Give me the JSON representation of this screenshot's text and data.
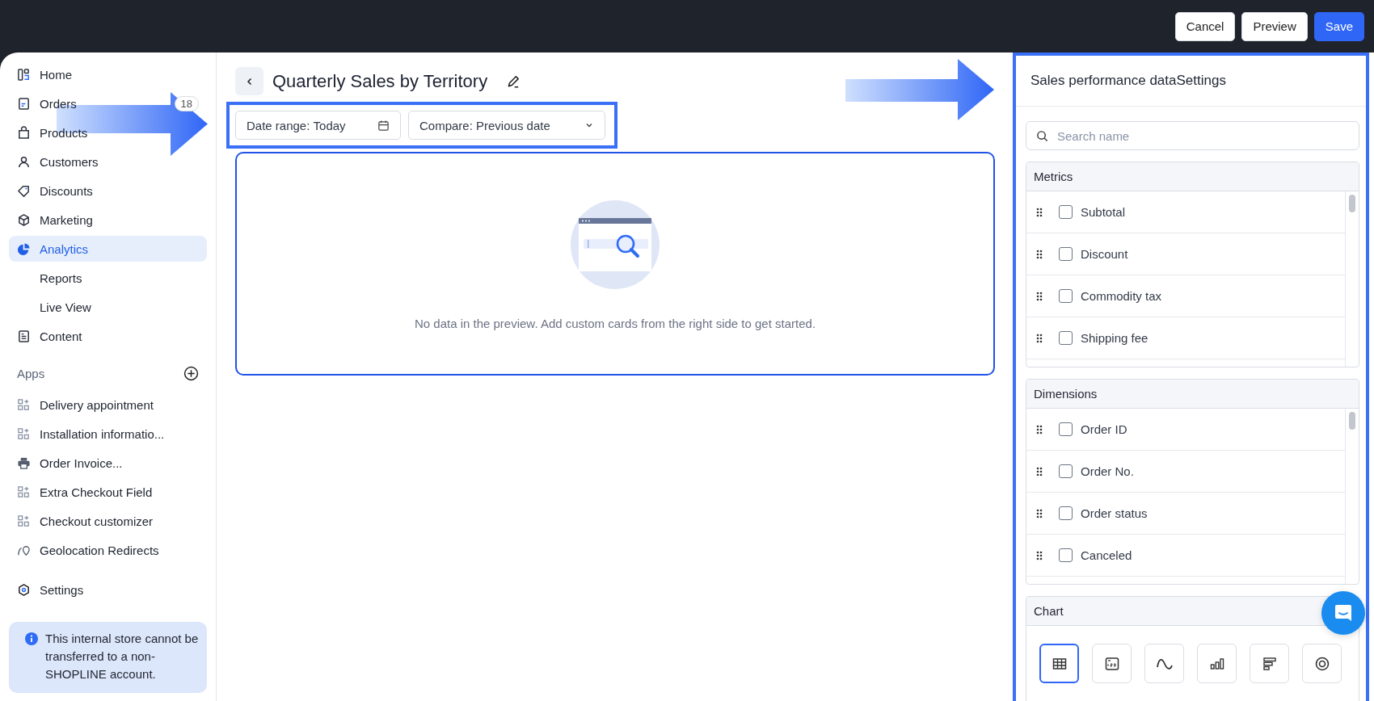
{
  "top_bar": {
    "buttons": [
      {
        "label": "Cancel",
        "kind": "default"
      },
      {
        "label": "Preview",
        "kind": "default"
      },
      {
        "label": "Save",
        "kind": "primary"
      }
    ]
  },
  "sidebar": {
    "items": [
      {
        "label": "Home",
        "selected": false
      },
      {
        "label": "Orders",
        "selected": false,
        "badge": "18"
      },
      {
        "label": "Products",
        "selected": false
      },
      {
        "label": "Customers",
        "selected": false
      },
      {
        "label": "Discounts",
        "selected": false
      },
      {
        "label": "Marketing",
        "selected": false
      },
      {
        "label": "Analytics",
        "selected": true,
        "children": [
          {
            "label": "Reports",
            "selected": false
          },
          {
            "label": "Live View",
            "selected": false
          }
        ]
      },
      {
        "label": "Content",
        "selected": false
      }
    ],
    "apps": {
      "title": "Apps",
      "items": [
        {
          "label": "Delivery appointment"
        },
        {
          "label": "Installation informatio..."
        },
        {
          "label": "Order Invoice..."
        },
        {
          "label": "Extra Checkout Field"
        },
        {
          "label": "Checkout customizer"
        },
        {
          "label": "Geolocation Redirects"
        }
      ]
    },
    "settings": "Settings",
    "notice": "This internal store cannot be transferred to a non-SHOPLINE account."
  },
  "page": {
    "title": "Quarterly Sales by Territory",
    "filters": [
      {
        "label": "Date range:",
        "value": "Today",
        "kind": "calendar"
      },
      {
        "label": "Compare:",
        "value": "Previous date",
        "kind": "dropdown"
      }
    ],
    "empty_message": "No data in the preview. Add custom cards from the right side to get started."
  },
  "panel": {
    "title": "Sales performance dataSettings",
    "search": {
      "placeholder": "Search name"
    },
    "sections": [
      {
        "title": "Metrics",
        "items": [
          {
            "label": "Subtotal",
            "checked": false
          },
          {
            "label": "Discount",
            "checked": false
          },
          {
            "label": "Commodity tax",
            "checked": false
          },
          {
            "label": "Shipping fee",
            "checked": false
          }
        ]
      },
      {
        "title": "Dimensions",
        "items": [
          {
            "label": "Order ID",
            "checked": false
          },
          {
            "label": "Order No.",
            "checked": false
          },
          {
            "label": "Order status",
            "checked": false
          },
          {
            "label": "Canceled",
            "checked": false
          }
        ]
      }
    ],
    "chart": {
      "title": "Chart",
      "types": [
        {
          "kind": "table",
          "selected": true
        },
        {
          "kind": "number",
          "selected": false
        },
        {
          "kind": "line",
          "selected": false
        },
        {
          "kind": "column",
          "selected": false
        },
        {
          "kind": "bar",
          "selected": false
        },
        {
          "kind": "donut",
          "selected": false
        }
      ]
    }
  }
}
